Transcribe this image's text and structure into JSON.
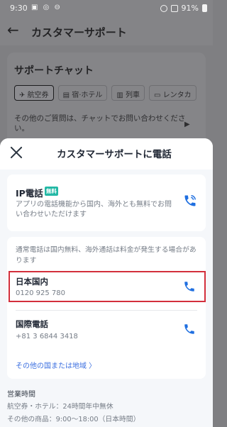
{
  "status_bar": {
    "time": "9:30",
    "left_icons": "▣ ◎ ⊖",
    "battery": "91%"
  },
  "background_page": {
    "title": "カスタマーサポート",
    "chat_title": "サポートチャット",
    "tabs": [
      {
        "label": "航空券",
        "active": true
      },
      {
        "label": "宿·ホテル",
        "active": false
      },
      {
        "label": "列車",
        "active": false
      },
      {
        "label": "レンタカ",
        "active": false
      }
    ],
    "ask_text": "その他のご質問は、チャットでお問い合わせください。"
  },
  "sheet": {
    "title": "カスタマーサポートに電話",
    "ip_call": {
      "title": "IP電話",
      "badge": "無料",
      "description": "アプリの電話機能から国内、海外とも無料でお問い合わせいただけます"
    },
    "note": "通常電話は国内無料、海外通話は料金が発生する場合があります",
    "domestic": {
      "title": "日本国内",
      "number": "0120 925 780"
    },
    "international": {
      "title": "国際電話",
      "number": "+81 3 6844 3418"
    },
    "other_link": "その他の国または地域 〉",
    "hours": {
      "title": "営業時間",
      "line1": "航空券・ホテル：24時間年中無休",
      "line2": "その他の商品：9:00～18:00（日本時間）"
    }
  },
  "colors": {
    "accent": "#1f6fe0",
    "badge": "#22b8a5",
    "highlight": "#d32f3c",
    "overlay": "#7f7f82"
  }
}
